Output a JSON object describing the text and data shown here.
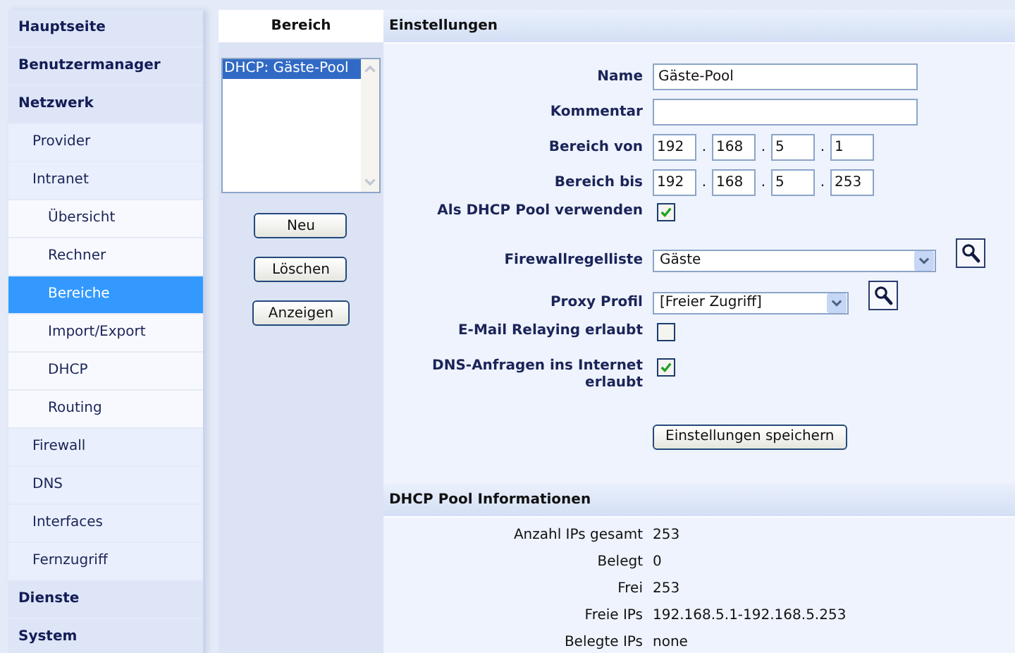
{
  "sidebar": {
    "items": [
      {
        "label": "Hauptseite",
        "selected": false
      },
      {
        "label": "Benutzermanager",
        "selected": false
      },
      {
        "label": "Netzwerk",
        "selected": false,
        "children": [
          {
            "label": "Provider",
            "selected": false
          },
          {
            "label": "Intranet",
            "selected": false,
            "children": [
              {
                "label": "Übersicht",
                "selected": false
              },
              {
                "label": "Rechner",
                "selected": false
              },
              {
                "label": "Bereiche",
                "selected": true
              },
              {
                "label": "Import/Export",
                "selected": false
              },
              {
                "label": "DHCP",
                "selected": false
              },
              {
                "label": "Routing",
                "selected": false
              }
            ]
          },
          {
            "label": "Firewall",
            "selected": false
          },
          {
            "label": "DNS",
            "selected": false
          },
          {
            "label": "Interfaces",
            "selected": false
          },
          {
            "label": "Fernzugriff",
            "selected": false
          }
        ]
      },
      {
        "label": "Dienste",
        "selected": false
      },
      {
        "label": "System",
        "selected": false
      }
    ]
  },
  "ranges": {
    "title": "Bereich",
    "items": [
      {
        "label": "DHCP: Gäste-Pool",
        "selected": true
      }
    ],
    "buttons": [
      "Neu",
      "Löschen",
      "Anzeigen"
    ]
  },
  "settings": {
    "title": "Einstellungen",
    "fields": [
      {
        "kind": "text",
        "label": "Name",
        "value": "Gäste-Pool"
      },
      {
        "kind": "text",
        "label": "Kommentar"
      },
      {
        "kind": "ip",
        "label": "Bereich von",
        "octets": [
          "192",
          "168",
          "5",
          "1"
        ],
        "separator": "."
      },
      {
        "kind": "ip",
        "label": "Bereich bis",
        "octets": [
          "192",
          "168",
          "5",
          "253"
        ],
        "separator": "."
      },
      {
        "kind": "checkbox",
        "label": "Als DHCP Pool verwenden",
        "checked": true
      },
      {
        "kind": "select",
        "label": "Firewallregelliste",
        "value": "Gäste"
      },
      {
        "kind": "select",
        "label": "Proxy Profil",
        "value": "[Freier Zugriff]"
      },
      {
        "kind": "checkbox",
        "label": "E-Mail Relaying erlaubt",
        "checked": false
      },
      {
        "kind": "checkbox",
        "label": "DNS-Anfragen ins Internet erlaubt",
        "checked": true
      }
    ],
    "save_button": "Einstellungen speichern"
  },
  "pool_info": {
    "title": "DHCP Pool Informationen",
    "rows": [
      {
        "label": "Anzahl IPs gesamt",
        "value": "253"
      },
      {
        "label": "Belegt",
        "value": "0"
      },
      {
        "label": "Frei",
        "value": "253"
      },
      {
        "label": "Freie IPs",
        "value": "192.168.5.1-192.168.5.253"
      },
      {
        "label": "Belegte IPs",
        "value": "none"
      }
    ]
  }
}
